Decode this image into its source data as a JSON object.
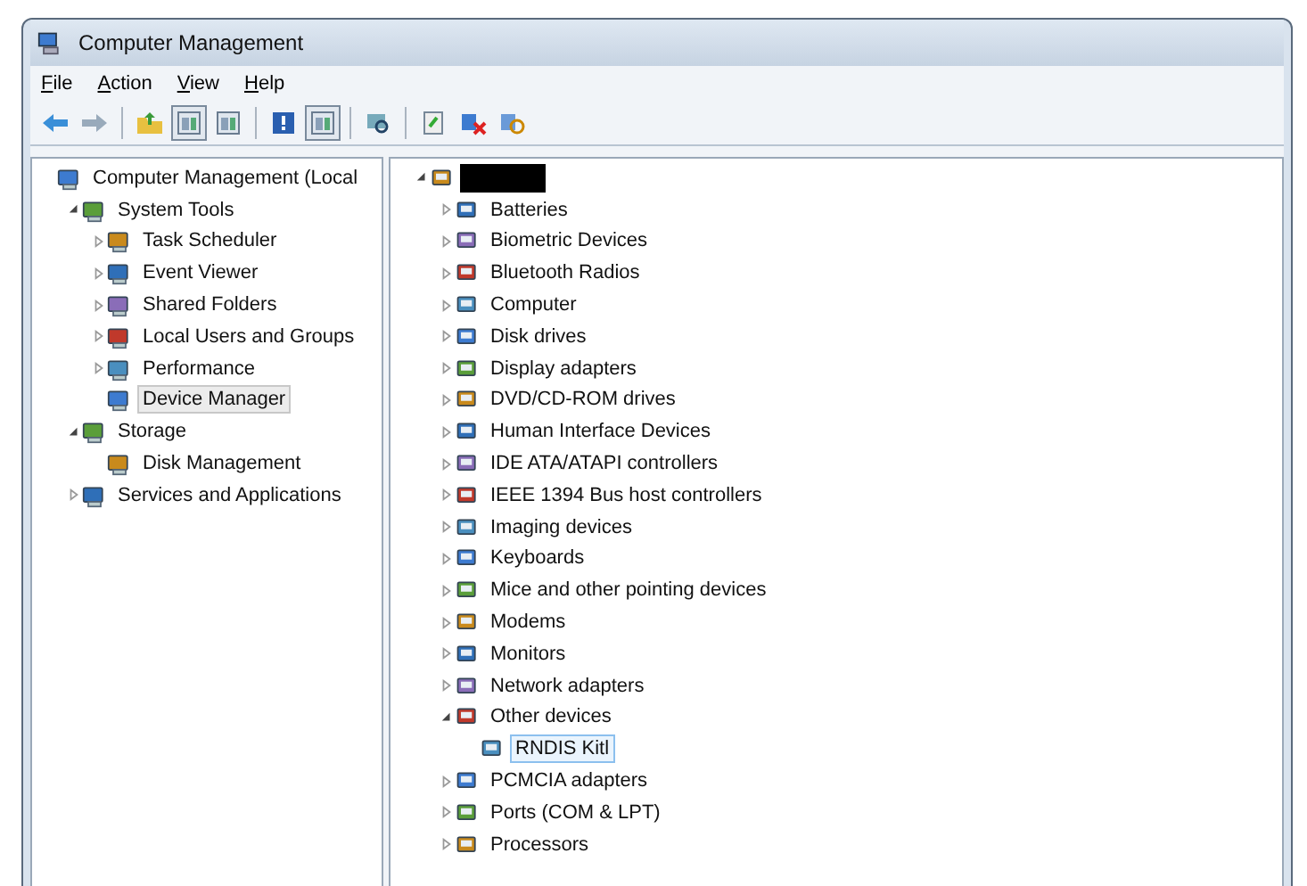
{
  "window": {
    "title": "Computer Management"
  },
  "menu": [
    "File",
    "Action",
    "View",
    "Help"
  ],
  "toolbar": [
    {
      "pressed": false
    },
    {
      "pressed": false
    },
    {
      "pressed": false
    },
    {
      "pressed": true
    },
    {
      "pressed": false
    },
    {
      "pressed": false
    },
    {
      "pressed": true
    },
    {
      "pressed": false
    },
    {
      "pressed": false
    },
    {
      "pressed": false
    },
    {
      "pressed": false
    }
  ],
  "left_tree": [
    {
      "label": "Computer Management (Local",
      "selected": false,
      "children": [
        {
          "label": "System Tools",
          "expanded": true,
          "selected": false,
          "children": [
            {
              "label": "Task Scheduler",
              "expanded": false,
              "selected": false
            },
            {
              "label": "Event Viewer",
              "expanded": false,
              "selected": false
            },
            {
              "label": "Shared Folders",
              "expanded": false,
              "selected": false
            },
            {
              "label": "Local Users and Groups",
              "expanded": false,
              "selected": false
            },
            {
              "label": "Performance",
              "expanded": false,
              "selected": false
            },
            {
              "label": "Device Manager",
              "selected": true
            }
          ]
        },
        {
          "label": "Storage",
          "expanded": true,
          "selected": false,
          "children": [
            {
              "label": "Disk Management",
              "selected": false
            }
          ]
        },
        {
          "label": "Services and Applications",
          "expanded": false,
          "selected": false
        }
      ]
    }
  ],
  "device_tree": [
    {
      "redacted": true,
      "expanded": true,
      "children": [
        {
          "label": "Batteries",
          "expanded": false,
          "selected": false
        },
        {
          "label": "Biometric Devices",
          "expanded": false,
          "selected": false
        },
        {
          "label": "Bluetooth Radios",
          "expanded": false,
          "selected": false
        },
        {
          "label": "Computer",
          "expanded": false,
          "selected": false
        },
        {
          "label": "Disk drives",
          "expanded": false,
          "selected": false
        },
        {
          "label": "Display adapters",
          "expanded": false,
          "selected": false
        },
        {
          "label": "DVD/CD-ROM drives",
          "expanded": false,
          "selected": false
        },
        {
          "label": "Human Interface Devices",
          "expanded": false,
          "selected": false
        },
        {
          "label": "IDE ATA/ATAPI controllers",
          "expanded": false,
          "selected": false
        },
        {
          "label": "IEEE 1394 Bus host controllers",
          "expanded": false,
          "selected": false
        },
        {
          "label": "Imaging devices",
          "expanded": false,
          "selected": false
        },
        {
          "label": "Keyboards",
          "expanded": false,
          "selected": false
        },
        {
          "label": "Mice and other pointing devices",
          "expanded": false,
          "selected": false
        },
        {
          "label": "Modems",
          "expanded": false,
          "selected": false
        },
        {
          "label": "Monitors",
          "expanded": false,
          "selected": false
        },
        {
          "label": "Network adapters",
          "expanded": false,
          "selected": false
        },
        {
          "label": "Other devices",
          "expanded": true,
          "selected": false,
          "children": [
            {
              "label": "RNDIS Kitl",
              "selected": true
            }
          ]
        },
        {
          "label": "PCMCIA adapters",
          "expanded": false,
          "selected": false
        },
        {
          "label": "Ports (COM & LPT)",
          "expanded": false,
          "selected": false
        },
        {
          "label": "Processors",
          "expanded": false,
          "selected": false
        }
      ]
    }
  ]
}
